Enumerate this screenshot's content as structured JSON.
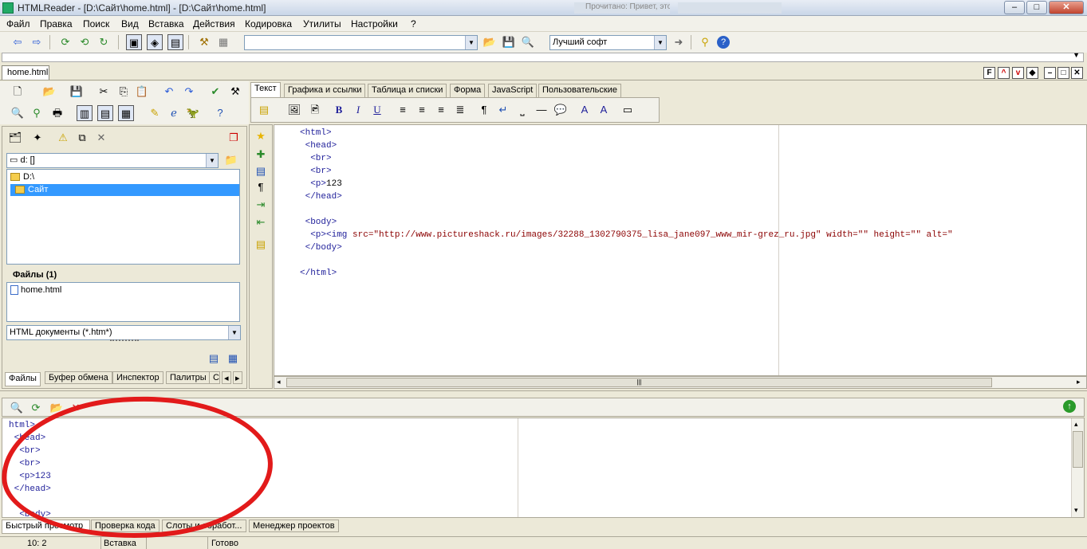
{
  "window": {
    "title": "HTMLReader - [D:\\Сайт\\home.html] - [D:\\Сайт\\home.html]",
    "background_taskbar_title": "Прочитано: Привет, это должностной..."
  },
  "menu": [
    "Файл",
    "Правка",
    "Поиск",
    "Вид",
    "Вставка",
    "Действия",
    "Кодировка",
    "Утилиты",
    "Настройки",
    "?"
  ],
  "toolbar": {
    "url_value": "",
    "search_engine": "Лучший софт"
  },
  "doc_tab": "home.html",
  "editor_tabs": [
    "Текст",
    "Графика и ссылки",
    "Таблица и списки",
    "Форма",
    "JavaScript",
    "Пользовательские"
  ],
  "sidebar": {
    "drive": "d: []",
    "tree": [
      "D:\\",
      "Сайт"
    ],
    "files_header": "Файлы (1)",
    "files": [
      "home.html"
    ],
    "filter": "HTML документы (*.htm*)",
    "tabs": [
      "Файлы",
      "Буфер обмена",
      "Инспектор",
      "Палитры",
      "С"
    ]
  },
  "editor_code": [
    {
      "indent": 0,
      "tag": "<html>"
    },
    {
      "indent": 1,
      "tag": "<head>"
    },
    {
      "indent": 2,
      "tag": "<br>"
    },
    {
      "indent": 2,
      "tag": "<br>"
    },
    {
      "indent": 2,
      "tag": "<p>",
      "text": "123"
    },
    {
      "indent": 1,
      "tag": "</head>"
    },
    {
      "indent": 0,
      "tag": ""
    },
    {
      "indent": 1,
      "tag": "<body>"
    },
    {
      "indent": 2,
      "tag": "<p><img",
      "attrs": " src=\"http://www.pictureshack.ru/images/32288_1302790375_lisa_jane097_www_mir-grez_ru.jpg\" width=\"\" height=\"\" alt=\""
    },
    {
      "indent": 1,
      "tag": "</body>"
    },
    {
      "indent": 0,
      "tag": ""
    },
    {
      "indent": 0,
      "tag": "</html>"
    }
  ],
  "preview_code": [
    "html>",
    " <head>",
    "  <br>",
    "  <br>",
    "  <p>123",
    " </head>",
    "",
    "  <body>"
  ],
  "bottom_tabs": [
    "Быстрый просмотр",
    "Проверка кода",
    "Слоты и обработ...",
    "Менеджер проектов"
  ],
  "status": {
    "position": "10:  2",
    "mode": "Вставка",
    "message": "Готово"
  },
  "colors": {
    "annotation": "#e21a1a",
    "tag": "#1f1f9a",
    "selection": "#3399ff"
  }
}
